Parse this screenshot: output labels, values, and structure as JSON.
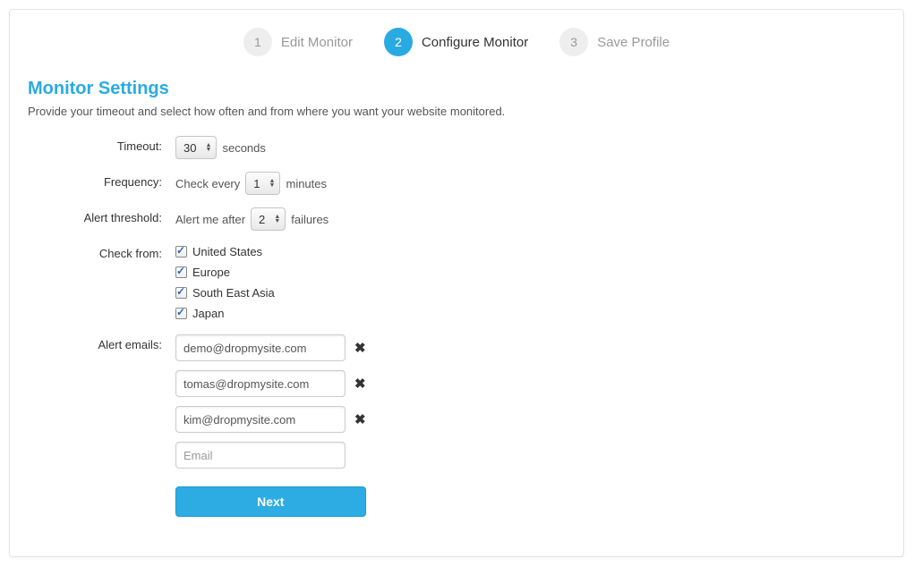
{
  "steps": [
    {
      "num": "1",
      "label": "Edit Monitor",
      "active": false
    },
    {
      "num": "2",
      "label": "Configure Monitor",
      "active": true
    },
    {
      "num": "3",
      "label": "Save Profile",
      "active": false
    }
  ],
  "section": {
    "title": "Monitor Settings",
    "description": "Provide your timeout and select how often and from where you want your website monitored."
  },
  "form": {
    "timeout": {
      "label": "Timeout:",
      "value": "30",
      "unit": "seconds"
    },
    "frequency": {
      "label": "Frequency:",
      "prefix": "Check every",
      "value": "1",
      "unit": "minutes"
    },
    "threshold": {
      "label": "Alert threshold:",
      "prefix": "Alert me after",
      "value": "2",
      "unit": "failures"
    },
    "checkfrom": {
      "label": "Check from:",
      "options": [
        {
          "name": "United States",
          "checked": true
        },
        {
          "name": "Europe",
          "checked": true
        },
        {
          "name": "South East Asia",
          "checked": true
        },
        {
          "name": "Japan",
          "checked": true
        }
      ]
    },
    "emails": {
      "label": "Alert emails:",
      "list": [
        "demo@dropmysite.com",
        "tomas@dropmysite.com",
        "kim@dropmysite.com"
      ],
      "placeholder": "Email"
    },
    "next_button": "Next"
  }
}
